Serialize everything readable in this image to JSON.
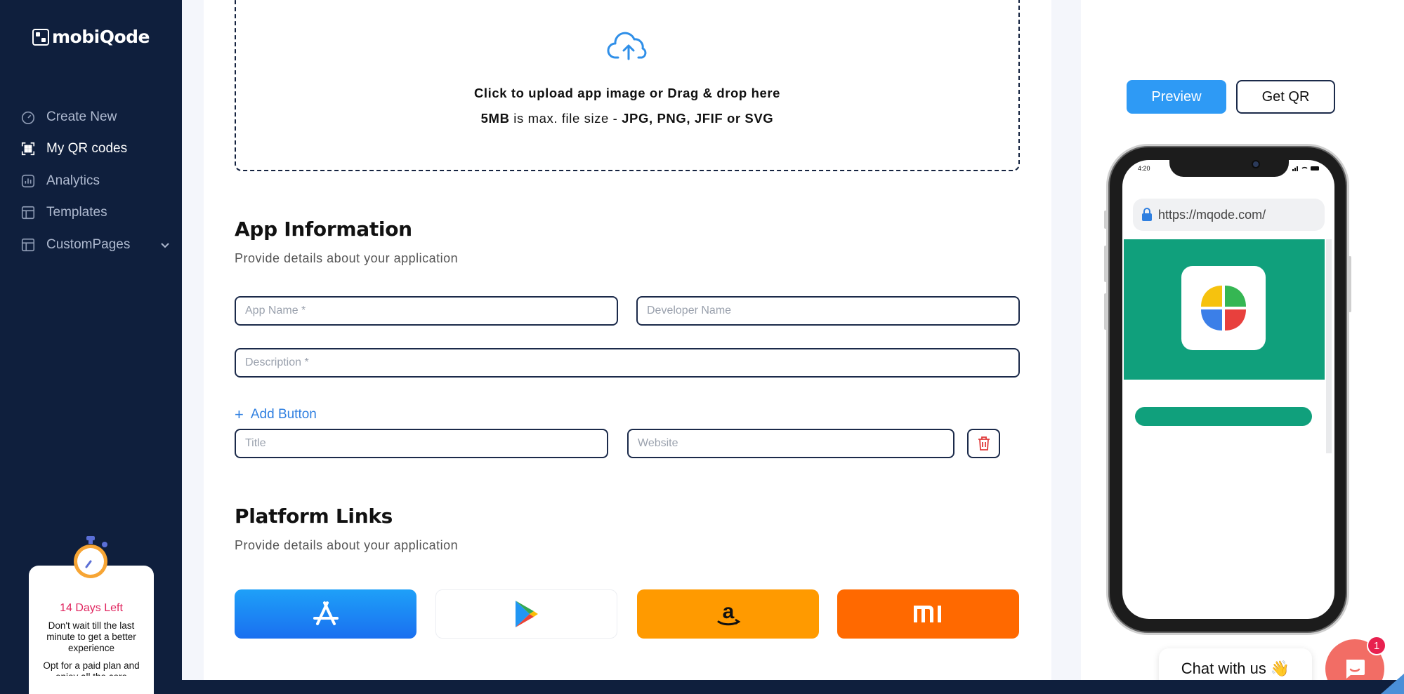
{
  "brand": {
    "name": "mobiQode"
  },
  "sidebar": {
    "items": [
      {
        "label": "Create New",
        "icon": "gauge-icon"
      },
      {
        "label": "My QR codes",
        "icon": "qr-grid-icon",
        "active": true
      },
      {
        "label": "Analytics",
        "icon": "bar-chart-icon"
      },
      {
        "label": "Templates",
        "icon": "template-icon"
      },
      {
        "label": "CustomPages",
        "icon": "pages-icon",
        "has_submenu": true
      }
    ],
    "trial": {
      "title": "14 Days Left",
      "text": "Don't wait till the last minute to get a better experience",
      "text2": "Opt for a paid plan and enjoy all the core"
    }
  },
  "upload": {
    "line1": "Click to upload app image or Drag & drop here",
    "size": "5MB",
    "middle": " is max. file size - ",
    "formats": "JPG, PNG, JFIF or SVG"
  },
  "app_info": {
    "title": "App Information",
    "subtitle": "Provide details about your application",
    "app_name_placeholder": "App Name *",
    "developer_placeholder": "Developer Name",
    "description_placeholder": "Description *",
    "add_button_label": "Add Button",
    "title_placeholder": "Title",
    "website_placeholder": "Website"
  },
  "platform_links": {
    "title": "Platform Links",
    "subtitle": "Provide details about your application",
    "platforms": [
      "App Store",
      "Google Play",
      "Amazon",
      "Xiaomi"
    ]
  },
  "preview": {
    "preview_label": "Preview",
    "get_qr_label": "Get QR",
    "status_time": "4:20",
    "url": "https://mqode.com/"
  },
  "chat": {
    "label": "Chat with us",
    "emoji": "👋",
    "badge": "1"
  },
  "colors": {
    "sidebar_bg": "#0f1f3d",
    "accent_blue": "#2e9af5",
    "preview_green": "#10a07c",
    "chat_red": "#f26d65"
  }
}
